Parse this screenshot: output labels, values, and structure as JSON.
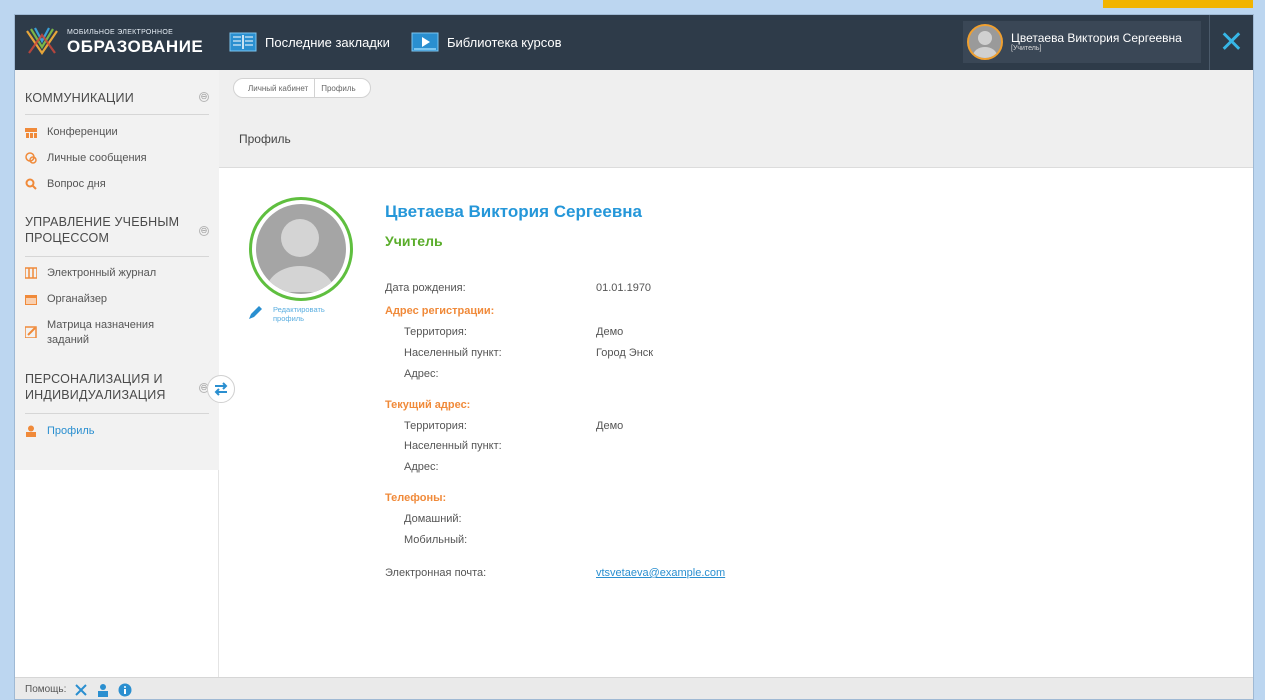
{
  "app": {
    "logo_small": "МОБИЛЬНОЕ ЭЛЕКТРОННОЕ",
    "logo_big": "ОБРАЗОВАНИЕ",
    "nav_bookmarks": "Последние закладки",
    "nav_library": "Библиотека курсов",
    "user_name": "Цветаева Виктория Сергеевна",
    "user_role": "[Учитель]",
    "close_icon": "✕"
  },
  "sidebar": {
    "sections": [
      {
        "title": "КОММУНИКАЦИИ",
        "items": [
          "Конференции",
          "Личные сообщения",
          "Вопрос дня"
        ]
      },
      {
        "title_line1": "УПРАВЛЕНИЕ УЧЕБНЫМ",
        "title_line2": "ПРОЦЕССОМ",
        "items": [
          "Электронный журнал",
          "Органайзер",
          "Матрица назначения",
          "заданий"
        ]
      },
      {
        "title_line1": "ПЕРСОНАЛИЗАЦИЯ И",
        "title_line2": "ИНДИВИДУАЛИЗАЦИЯ",
        "items": [
          "Профиль"
        ]
      }
    ],
    "toggle_symbol": "⊖"
  },
  "breadcrumb": [
    "Личный кабинет",
    "Профиль"
  ],
  "page_title": "Профиль",
  "profile": {
    "edit_link": "Редактировать профиль",
    "full_name": "Цветаева Виктория Сергеевна",
    "role": "Учитель",
    "birth_label": "Дата рождения:",
    "birth_value": "01.01.1970",
    "reg_address_title": "Адрес регистрации:",
    "territory_label": "Территория:",
    "locality_label": "Населенный пункт:",
    "address_label": "Адрес:",
    "reg_territory": "Демо",
    "reg_locality": "Город Энск",
    "current_address_title": "Текущий адрес:",
    "cur_territory": "Демо",
    "phones_title": "Телефоны:",
    "home_label": "Домашний:",
    "mobile_label": "Мобильный:",
    "email_label": "Электронная почта:",
    "email_value": "vtsvetaeva@example.com"
  },
  "footer": {
    "help_label": "Помощь:"
  },
  "colors": {
    "accent_blue": "#2597d9",
    "accent_green": "#5aad2b",
    "accent_orange": "#f08a3a",
    "topbar": "#2e3b49"
  }
}
